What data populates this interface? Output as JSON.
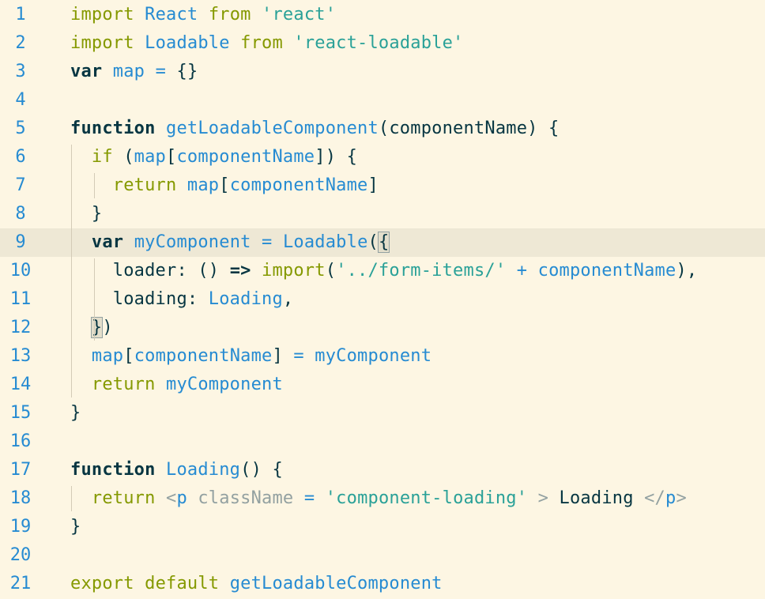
{
  "editor": {
    "current_line": 9,
    "colors": {
      "background": "#FDF6E3",
      "line_highlight": "#EEE8D5",
      "keyword": "#859900",
      "identifier": "#268BD2",
      "string": "#2AA198",
      "text": "#073642",
      "jsx_tag": "#93A1A1"
    },
    "lines": [
      {
        "num": "1",
        "tokens": [
          {
            "t": "import",
            "c": "kw"
          },
          {
            "t": " ",
            "c": "plain"
          },
          {
            "t": "React",
            "c": "ident"
          },
          {
            "t": " ",
            "c": "plain"
          },
          {
            "t": "from",
            "c": "kw"
          },
          {
            "t": " ",
            "c": "plain"
          },
          {
            "t": "'react'",
            "c": "str"
          }
        ]
      },
      {
        "num": "2",
        "tokens": [
          {
            "t": "import",
            "c": "kw"
          },
          {
            "t": " ",
            "c": "plain"
          },
          {
            "t": "Loadable",
            "c": "ident"
          },
          {
            "t": " ",
            "c": "plain"
          },
          {
            "t": "from",
            "c": "kw"
          },
          {
            "t": " ",
            "c": "plain"
          },
          {
            "t": "'react-loadable'",
            "c": "str"
          }
        ]
      },
      {
        "num": "3",
        "tokens": [
          {
            "t": "var",
            "c": "kwb"
          },
          {
            "t": " ",
            "c": "plain"
          },
          {
            "t": "map",
            "c": "ident"
          },
          {
            "t": " ",
            "c": "plain"
          },
          {
            "t": "=",
            "c": "op"
          },
          {
            "t": " ",
            "c": "plain"
          },
          {
            "t": "{}",
            "c": "plain"
          }
        ]
      },
      {
        "num": "4",
        "tokens": []
      },
      {
        "num": "5",
        "tokens": [
          {
            "t": "function",
            "c": "kwb"
          },
          {
            "t": " ",
            "c": "plain"
          },
          {
            "t": "getLoadableComponent",
            "c": "ident"
          },
          {
            "t": "(componentName) {",
            "c": "plain"
          }
        ]
      },
      {
        "num": "6",
        "tokens": [
          {
            "t": "  ",
            "c": "plain"
          },
          {
            "t": "if",
            "c": "kw"
          },
          {
            "t": " (",
            "c": "plain"
          },
          {
            "t": "map",
            "c": "ident"
          },
          {
            "t": "[",
            "c": "plain"
          },
          {
            "t": "componentName",
            "c": "ident"
          },
          {
            "t": "]) {",
            "c": "plain"
          }
        ]
      },
      {
        "num": "7",
        "tokens": [
          {
            "t": "    ",
            "c": "plain"
          },
          {
            "t": "return",
            "c": "kw"
          },
          {
            "t": " ",
            "c": "plain"
          },
          {
            "t": "map",
            "c": "ident"
          },
          {
            "t": "[",
            "c": "plain"
          },
          {
            "t": "componentName",
            "c": "ident"
          },
          {
            "t": "]",
            "c": "plain"
          }
        ]
      },
      {
        "num": "8",
        "tokens": [
          {
            "t": "  }",
            "c": "plain"
          }
        ]
      },
      {
        "num": "9",
        "tokens": [
          {
            "t": "  ",
            "c": "plain"
          },
          {
            "t": "var",
            "c": "kwb"
          },
          {
            "t": " ",
            "c": "plain"
          },
          {
            "t": "myComponent",
            "c": "ident"
          },
          {
            "t": " ",
            "c": "plain"
          },
          {
            "t": "=",
            "c": "op"
          },
          {
            "t": " ",
            "c": "plain"
          },
          {
            "t": "Loadable",
            "c": "ident"
          },
          {
            "t": "(",
            "c": "plain"
          },
          {
            "t": "{",
            "c": "plain match"
          }
        ]
      },
      {
        "num": "10",
        "tokens": [
          {
            "t": "    loader: () ",
            "c": "plain"
          },
          {
            "t": "=>",
            "c": "kwb"
          },
          {
            "t": " ",
            "c": "plain"
          },
          {
            "t": "import",
            "c": "kw"
          },
          {
            "t": "(",
            "c": "plain"
          },
          {
            "t": "'../form-items/'",
            "c": "str"
          },
          {
            "t": " ",
            "c": "plain"
          },
          {
            "t": "+",
            "c": "op"
          },
          {
            "t": " ",
            "c": "plain"
          },
          {
            "t": "componentName",
            "c": "ident"
          },
          {
            "t": "),",
            "c": "plain"
          }
        ]
      },
      {
        "num": "11",
        "tokens": [
          {
            "t": "    loading: ",
            "c": "plain"
          },
          {
            "t": "Loading",
            "c": "ident"
          },
          {
            "t": ",",
            "c": "plain"
          }
        ]
      },
      {
        "num": "12",
        "tokens": [
          {
            "t": "  ",
            "c": "plain"
          },
          {
            "t": "}",
            "c": "plain match"
          },
          {
            "t": ")",
            "c": "plain"
          }
        ]
      },
      {
        "num": "13",
        "tokens": [
          {
            "t": "  ",
            "c": "plain"
          },
          {
            "t": "map",
            "c": "ident"
          },
          {
            "t": "[",
            "c": "plain"
          },
          {
            "t": "componentName",
            "c": "ident"
          },
          {
            "t": "] ",
            "c": "plain"
          },
          {
            "t": "=",
            "c": "op"
          },
          {
            "t": " ",
            "c": "plain"
          },
          {
            "t": "myComponent",
            "c": "ident"
          }
        ]
      },
      {
        "num": "14",
        "tokens": [
          {
            "t": "  ",
            "c": "plain"
          },
          {
            "t": "return",
            "c": "kw"
          },
          {
            "t": " ",
            "c": "plain"
          },
          {
            "t": "myComponent",
            "c": "ident"
          }
        ]
      },
      {
        "num": "15",
        "tokens": [
          {
            "t": "}",
            "c": "plain"
          }
        ]
      },
      {
        "num": "16",
        "tokens": []
      },
      {
        "num": "17",
        "tokens": [
          {
            "t": "function",
            "c": "kwb"
          },
          {
            "t": " ",
            "c": "plain"
          },
          {
            "t": "Loading",
            "c": "ident"
          },
          {
            "t": "() {",
            "c": "plain"
          }
        ]
      },
      {
        "num": "18",
        "tokens": [
          {
            "t": "  ",
            "c": "plain"
          },
          {
            "t": "return",
            "c": "kw"
          },
          {
            "t": " ",
            "c": "plain"
          },
          {
            "t": "<",
            "c": "tag"
          },
          {
            "t": "p",
            "c": "ident"
          },
          {
            "t": " className ",
            "c": "tag"
          },
          {
            "t": "=",
            "c": "op"
          },
          {
            "t": " ",
            "c": "plain"
          },
          {
            "t": "'component-loading'",
            "c": "str"
          },
          {
            "t": " > ",
            "c": "tag"
          },
          {
            "t": "Loading ",
            "c": "plain"
          },
          {
            "t": "</",
            "c": "tag"
          },
          {
            "t": "p",
            "c": "ident"
          },
          {
            "t": ">",
            "c": "tag"
          }
        ]
      },
      {
        "num": "19",
        "tokens": [
          {
            "t": "}",
            "c": "plain"
          }
        ]
      },
      {
        "num": "20",
        "tokens": []
      },
      {
        "num": "21",
        "tokens": [
          {
            "t": "export",
            "c": "kw"
          },
          {
            "t": " ",
            "c": "plain"
          },
          {
            "t": "default",
            "c": "kw"
          },
          {
            "t": " ",
            "c": "plain"
          },
          {
            "t": "getLoadableComponent",
            "c": "ident"
          }
        ]
      }
    ]
  }
}
